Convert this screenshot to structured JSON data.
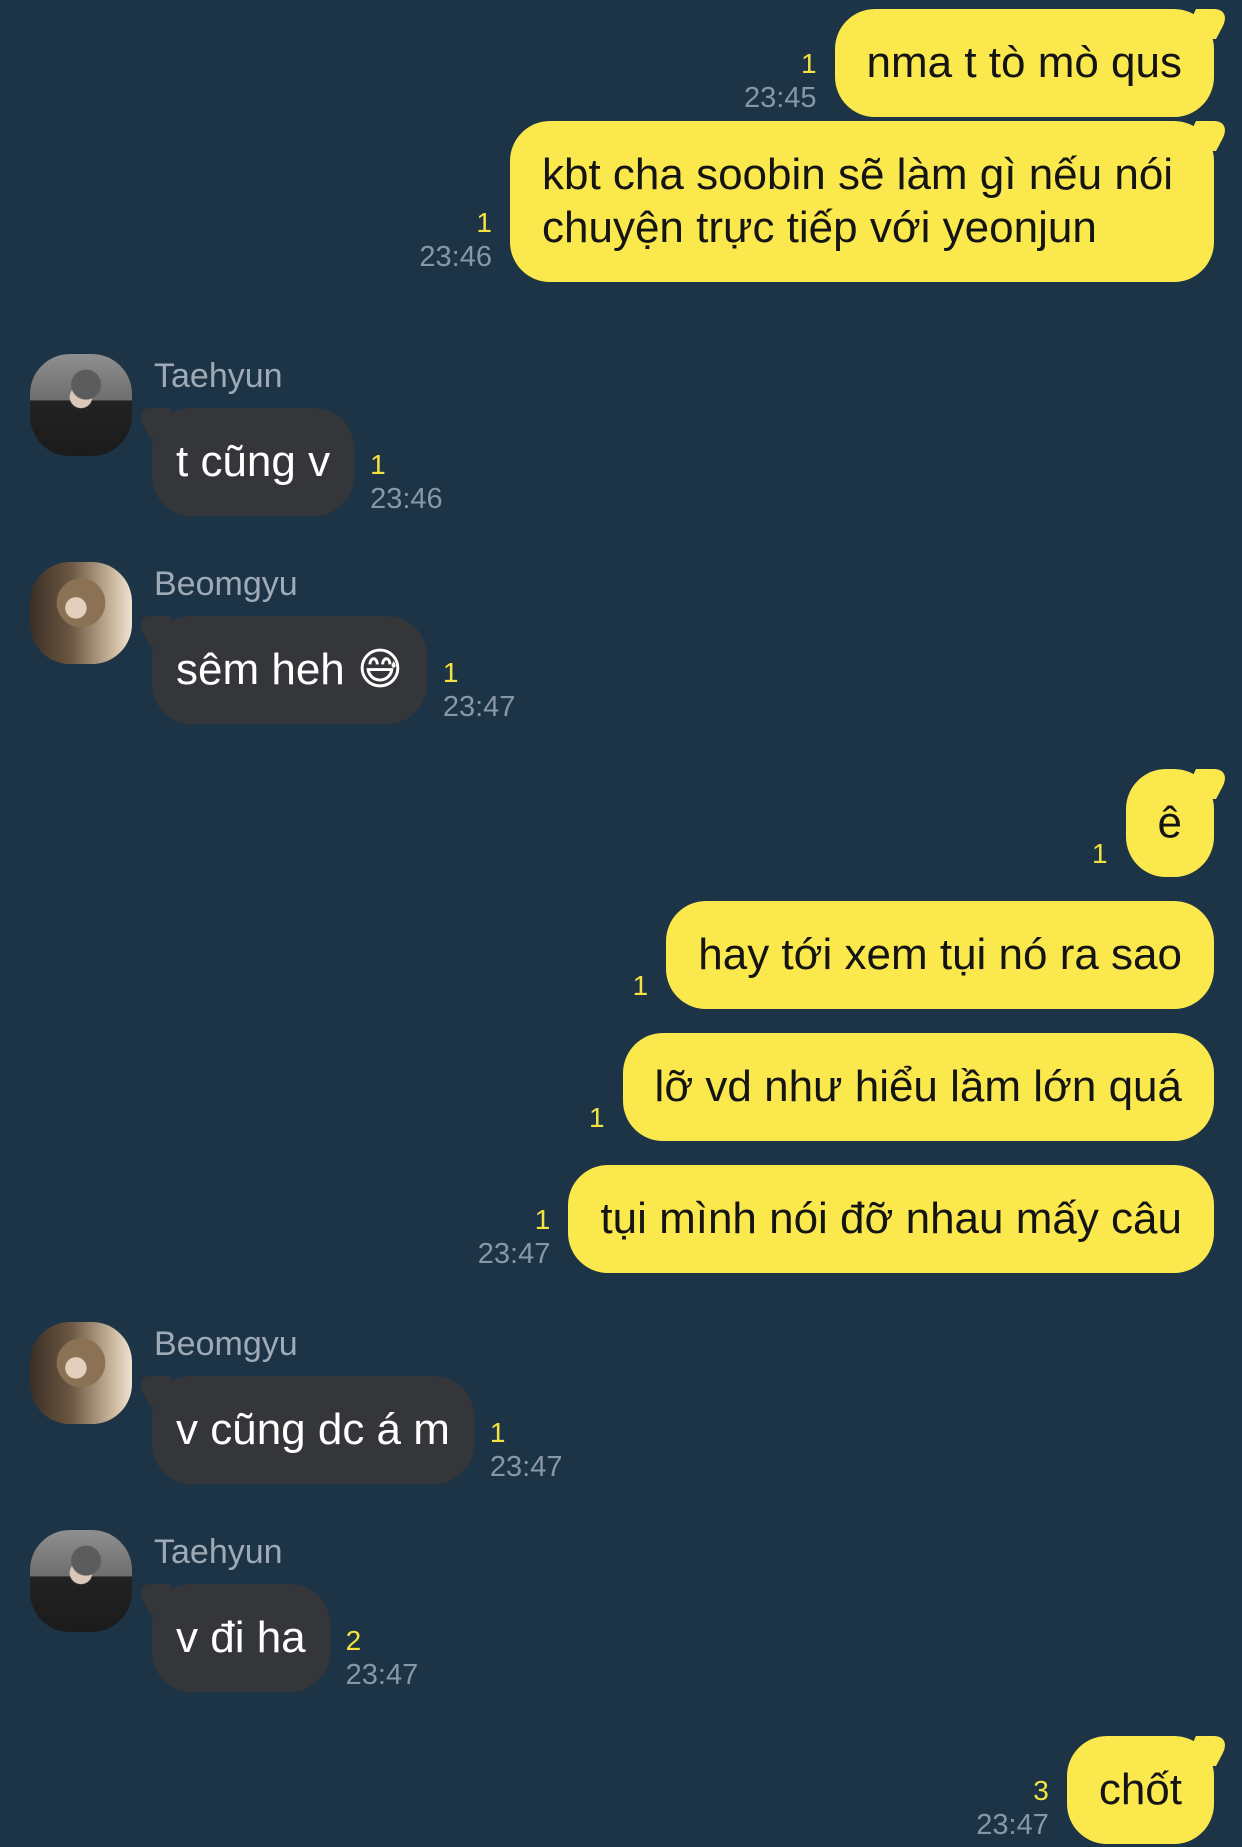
{
  "colors": {
    "background": "#1d3446",
    "sent_bubble": "#fae84d",
    "received_bubble": "#353639",
    "unread_count": "#f3e23f",
    "timestamp": "#8797a6",
    "sender_name": "#9eaab6"
  },
  "messages": [
    {
      "id": "m1",
      "direction": "sent",
      "text": "nma t tò mò qus",
      "unread": "1",
      "time": "23:45"
    },
    {
      "id": "m2",
      "direction": "sent",
      "text": "kbt cha soobin sẽ làm gì nếu nói chuyện trực tiếp với yeonjun",
      "unread": "1",
      "time": "23:46"
    },
    {
      "id": "m3",
      "direction": "received",
      "sender": "Taehyun",
      "avatar_icon": "taehyun-avatar",
      "text": "t cũng v",
      "unread": "1",
      "time": "23:46"
    },
    {
      "id": "m4",
      "direction": "received",
      "sender": "Beomgyu",
      "avatar_icon": "beomgyu-avatar",
      "text": "sêm heh 😅",
      "unread": "1",
      "time": "23:47"
    },
    {
      "id": "m5",
      "direction": "sent",
      "text": "ê",
      "unread": "1",
      "time": ""
    },
    {
      "id": "m6",
      "direction": "sent",
      "text": "hay tới xem tụi nó ra sao",
      "unread": "1",
      "time": ""
    },
    {
      "id": "m7",
      "direction": "sent",
      "text": "lỡ vd như hiểu lầm lớn quá",
      "unread": "1",
      "time": ""
    },
    {
      "id": "m8",
      "direction": "sent",
      "text": "tụi mình nói đỡ nhau mấy câu",
      "unread": "1",
      "time": "23:47"
    },
    {
      "id": "m9",
      "direction": "received",
      "sender": "Beomgyu",
      "avatar_icon": "beomgyu-avatar",
      "text": "v cũng dc á m",
      "unread": "1",
      "time": "23:47"
    },
    {
      "id": "m10",
      "direction": "received",
      "sender": "Taehyun",
      "avatar_icon": "taehyun-avatar",
      "text": "v đi ha",
      "unread": "2",
      "time": "23:47"
    },
    {
      "id": "m11",
      "direction": "sent",
      "text": "chốt",
      "unread": "3",
      "time": "23:47"
    }
  ]
}
